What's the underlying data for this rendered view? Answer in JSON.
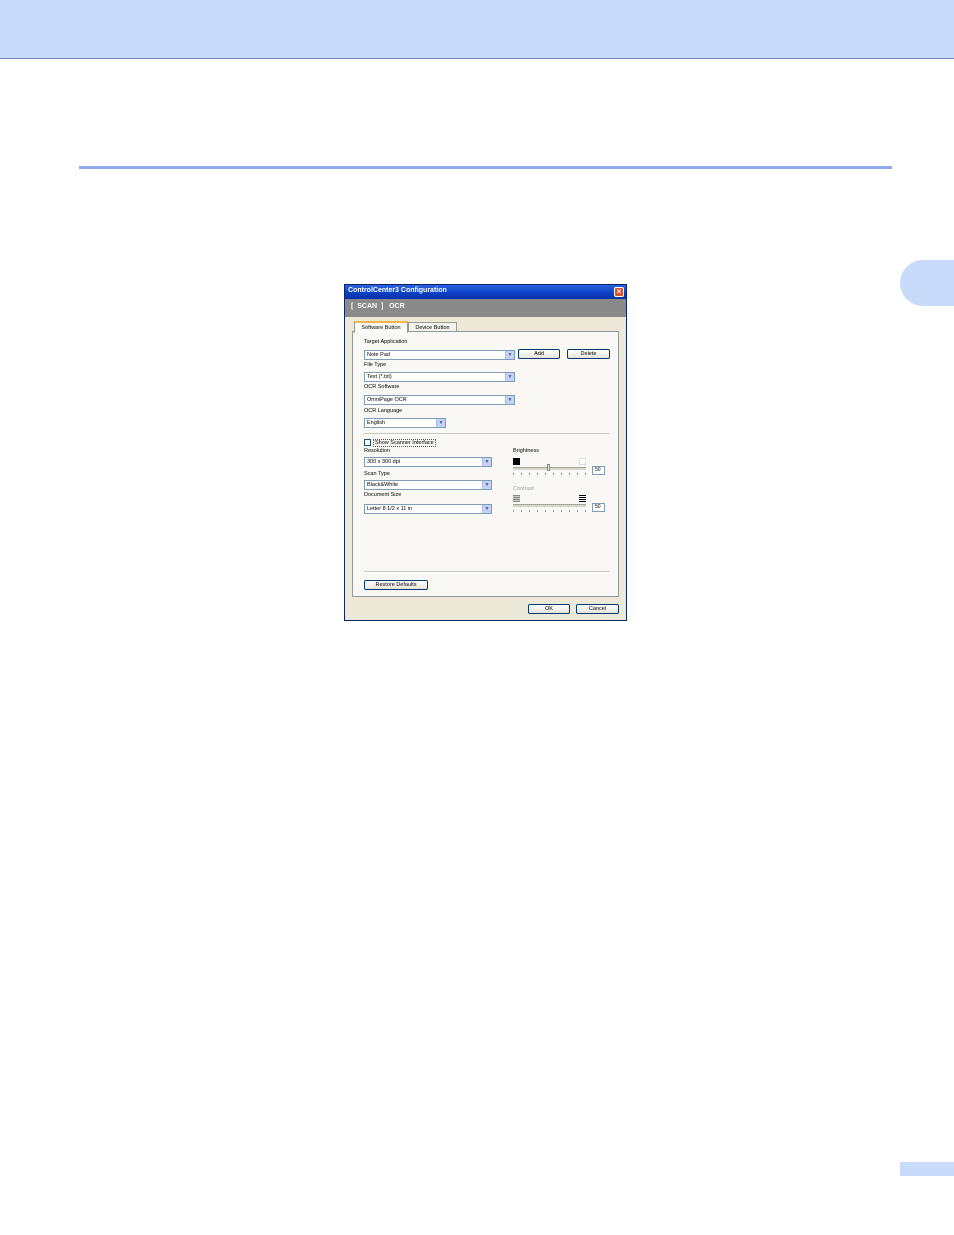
{
  "dialog": {
    "title": "ControlCenter3 Configuration",
    "close_glyph": "×",
    "banner": "[  SCAN  ]   OCR"
  },
  "tabs": [
    {
      "label": "Software Button",
      "active": true
    },
    {
      "label": "Device Button",
      "active": false
    }
  ],
  "software": {
    "target_app_label": "Target Application",
    "target_app_value": "Note Pad",
    "add_label": "Add",
    "delete_label": "Delete",
    "file_type_label": "File Type",
    "file_type_value": "Text (*.txt)",
    "ocr_software_label": "OCR Software",
    "ocr_software_value": "OmniPage OCR",
    "ocr_language_label": "OCR Language",
    "ocr_language_value": "English"
  },
  "scan": {
    "show_interface_label": "Show Scanner Interface",
    "show_interface_checked": false,
    "resolution_label": "Resolution",
    "resolution_value": "300 x 300 dpi",
    "scan_type_label": "Scan Type",
    "scan_type_value": "Black&White",
    "document_size_label": "Document Size",
    "document_size_value": "Letter 8 1/2 x 11 in",
    "brightness_label": "Brightness",
    "brightness_value": "50",
    "contrast_label": "Contrast",
    "contrast_value": "50"
  },
  "footer": {
    "restore_defaults_label": "Restore Defaults",
    "ok_label": "OK",
    "cancel_label": "Cancel"
  }
}
